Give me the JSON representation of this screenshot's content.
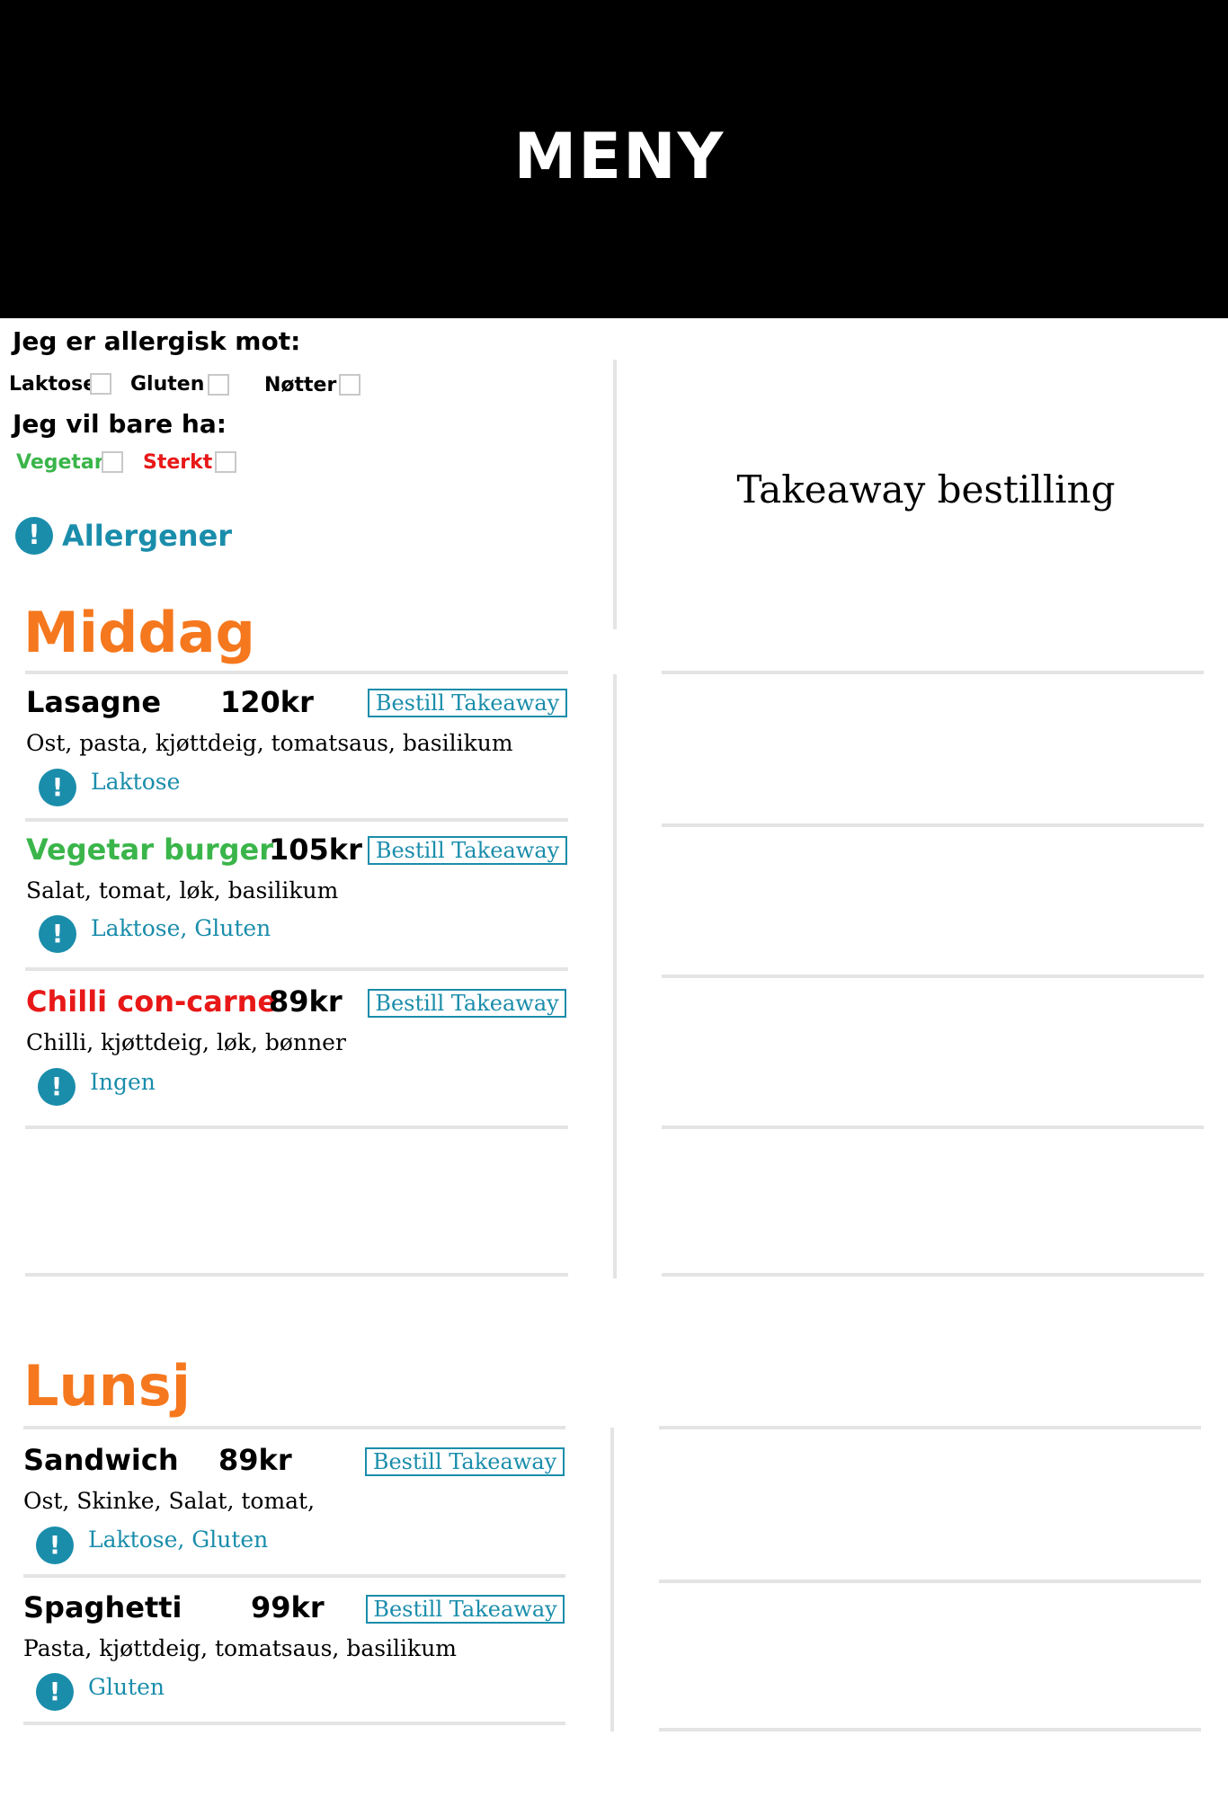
{
  "header": {
    "title": "MENY"
  },
  "filters": {
    "allergic_heading": "Jeg er allergisk mot:",
    "allergies": [
      {
        "label": "Laktose",
        "checked": false
      },
      {
        "label": "Gluten",
        "checked": false
      },
      {
        "label": "Nøtter",
        "checked": false
      }
    ],
    "preference_heading": "Jeg vil bare ha:",
    "preferences": [
      {
        "label": "Vegetar",
        "color": "#3ab54a",
        "checked": false
      },
      {
        "label": "Sterkt",
        "color": "#e81818",
        "checked": false
      }
    ],
    "allergen_link": {
      "label": "Allergener",
      "icon": "exclamation-icon"
    }
  },
  "takeaway": {
    "title": "Takeaway bestilling"
  },
  "colors": {
    "accent_orange": "#f5781e",
    "link_teal": "#1a8dab",
    "vegetarian_green": "#3ab54a",
    "spicy_red": "#e81818",
    "divider_gray": "#e4e4e4"
  },
  "sections": [
    {
      "title": "Middag",
      "items": [
        {
          "name": "Lasagne",
          "name_color": "#000000",
          "price": "120kr",
          "order_label": "Bestill Takeaway",
          "description": "Ost, pasta, kjøttdeig, tomatsaus, basilikum",
          "allergens": "Laktose",
          "icon": "exclamation-icon"
        },
        {
          "name": "Vegetar burger",
          "name_color": "#3ab54a",
          "price": "105kr",
          "order_label": "Bestill Takeaway",
          "description": "Salat, tomat, løk, basilikum",
          "allergens": "Laktose, Gluten",
          "icon": "exclamation-icon"
        },
        {
          "name": "Chilli con-carne",
          "name_color": "#e81818",
          "price": "89kr",
          "order_label": "Bestill Takeaway",
          "description": "Chilli, kjøttdeig, løk, bønner",
          "allergens": "Ingen",
          "icon": "exclamation-icon"
        }
      ]
    },
    {
      "title": "Lunsj",
      "items": [
        {
          "name": "Sandwich",
          "name_color": "#000000",
          "price": "89kr",
          "order_label": "Bestill Takeaway",
          "description": "Ost, Skinke, Salat, tomat,",
          "allergens": "Laktose, Gluten",
          "icon": "exclamation-icon"
        },
        {
          "name": "Spaghetti",
          "name_color": "#000000",
          "price": "99kr",
          "order_label": "Bestill Takeaway",
          "description": "Pasta, kjøttdeig, tomatsaus, basilikum",
          "allergens": "Gluten",
          "icon": "exclamation-icon"
        }
      ]
    }
  ]
}
